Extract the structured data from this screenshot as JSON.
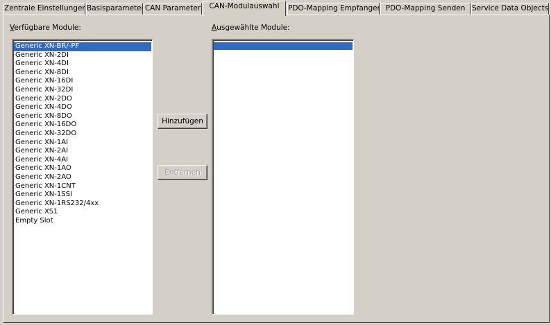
{
  "tabs": [
    {
      "label": "Zentrale Einstellungen"
    },
    {
      "label": "Basisparameter"
    },
    {
      "label": "CAN Parameter"
    },
    {
      "label": "CAN-Modulauswahl"
    },
    {
      "label": "PDO-Mapping Empfangen"
    },
    {
      "label": "PDO-Mapping Senden"
    },
    {
      "label": "Service Data Objects"
    }
  ],
  "active_tab": "CAN-Modulauswahl",
  "available": {
    "label": "Verfügbare Module:",
    "items": [
      "Generic XN-BR/-PF",
      "Generic XN-2DI",
      "Generic XN-4DI",
      "Generic XN-8DI",
      "Generic XN-16DI",
      "Generic XN-32DI",
      "Generic XN-2DO",
      "Generic XN-4DO",
      "Generic XN-8DO",
      "Generic XN-16DO",
      "Generic XN-32DO",
      "Generic XN-1AI",
      "Generic XN-2AI",
      "Generic XN-4AI",
      "Generic XN-1AO",
      "Generic XN-2AO",
      "Generic XN-1CNT",
      "Generic XN-1SSI",
      "Generic XN-1RS232/4xx",
      "Generic XS1",
      "Empty Slot"
    ],
    "selected_index": 0
  },
  "selected": {
    "label": "Ausgewählte Module:"
  },
  "buttons": {
    "add": "Hinzufügen",
    "remove": "Entfernen"
  },
  "colors": {
    "face": "#d4d0c8",
    "selection": "#316ac5"
  }
}
